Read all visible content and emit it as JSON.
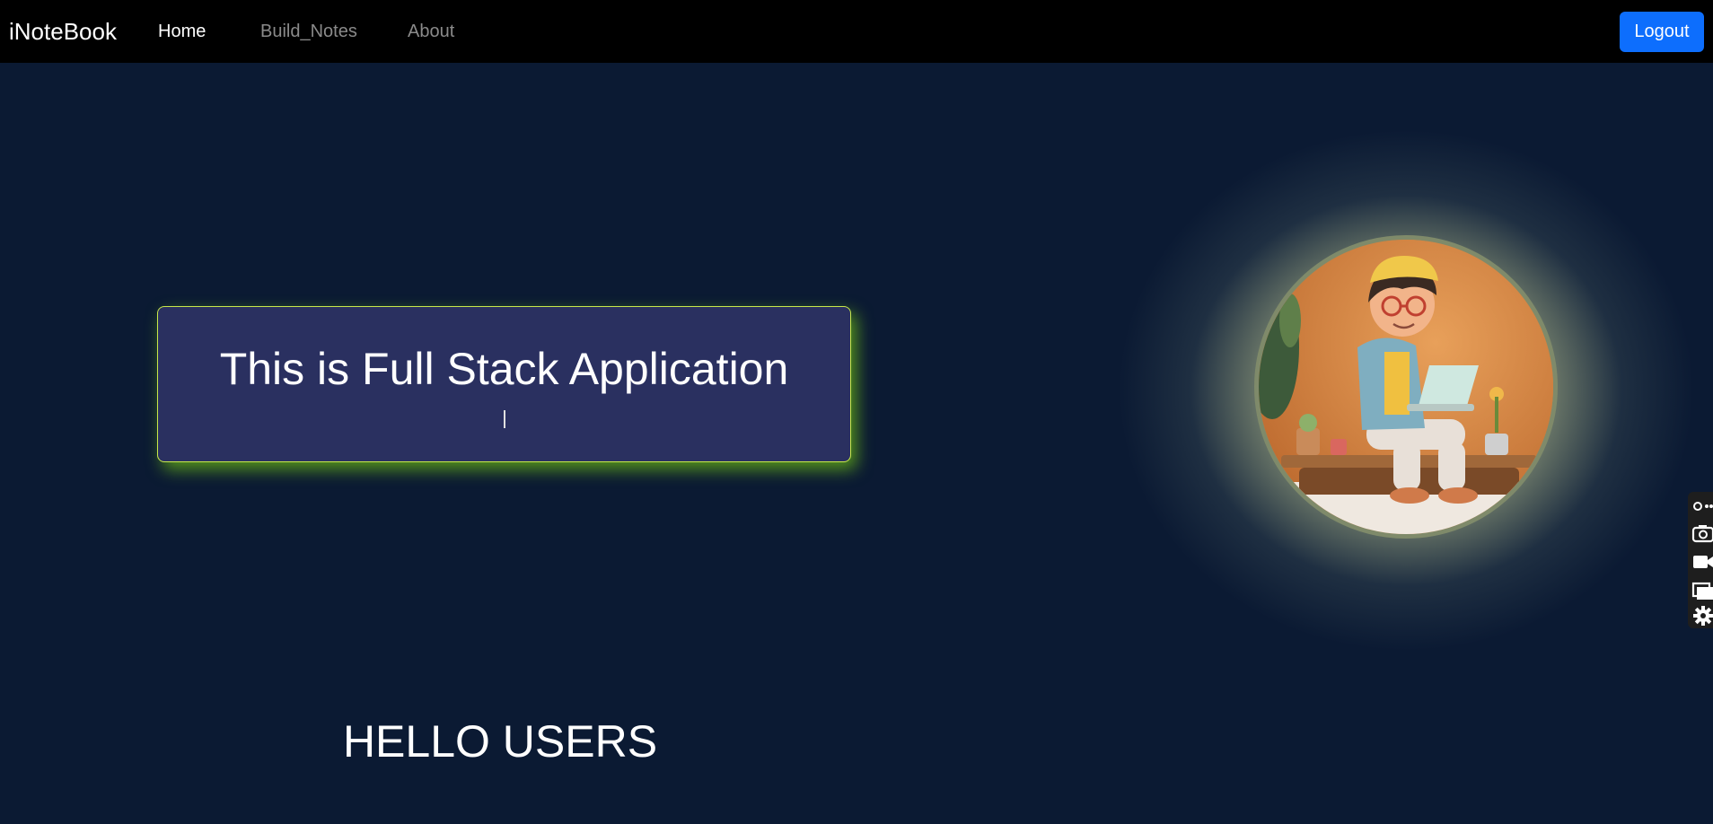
{
  "navbar": {
    "brand": "iNoteBook",
    "links": [
      {
        "label": "Home",
        "active": true
      },
      {
        "label": "Build_Notes",
        "active": false
      },
      {
        "label": "About",
        "active": false
      }
    ],
    "logout_label": "Logout"
  },
  "hero": {
    "title": "This is Full Stack Application"
  },
  "greeting": "HELLO USERS",
  "colors": {
    "background": "#0b1a33",
    "navbar": "#000000",
    "button": "#0d6efd",
    "hero_box": "#2a3060",
    "hero_glow": "#7ec020"
  },
  "side_toolbar": {
    "icons": [
      "link-icon",
      "camera-icon",
      "video-icon",
      "window-icon",
      "gear-icon"
    ]
  }
}
